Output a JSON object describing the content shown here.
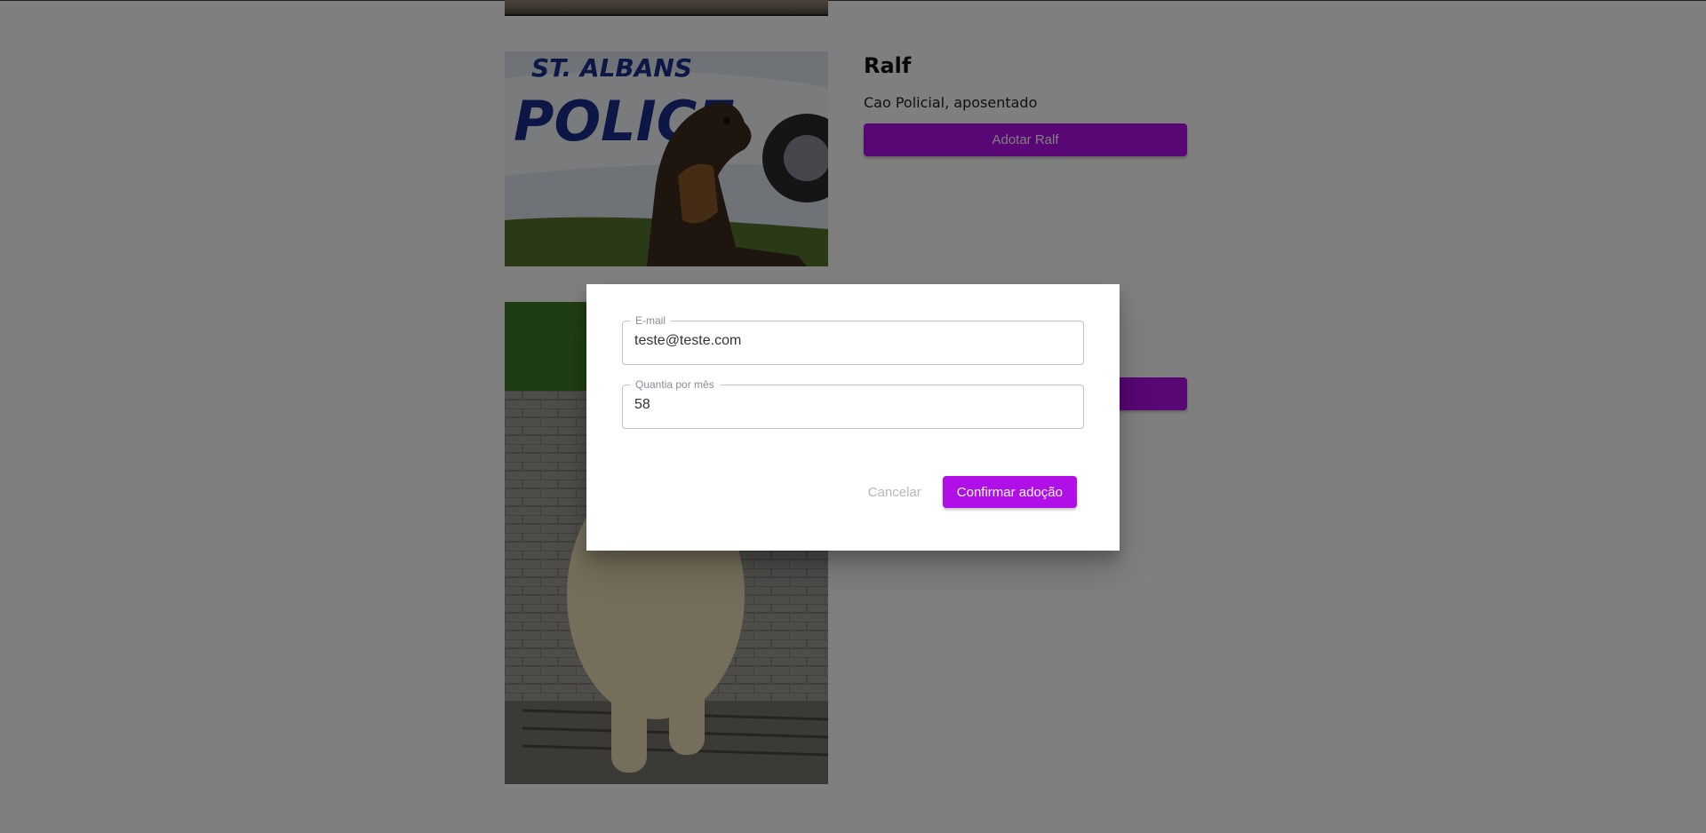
{
  "pets": [
    {
      "name": "Ralf",
      "description": "Cao Policial, aposentado",
      "adopt_label": "Adotar Ralf"
    }
  ],
  "dialog": {
    "email_label": "E-mail",
    "email_value": "teste@teste.com",
    "amount_label": "Quantia por mês",
    "amount_value": "58",
    "cancel_label": "Cancelar",
    "confirm_label": "Confirmar adoção"
  },
  "colors": {
    "accent": "#b00fe8",
    "backdrop": "rgba(0,0,0,0.5)"
  }
}
